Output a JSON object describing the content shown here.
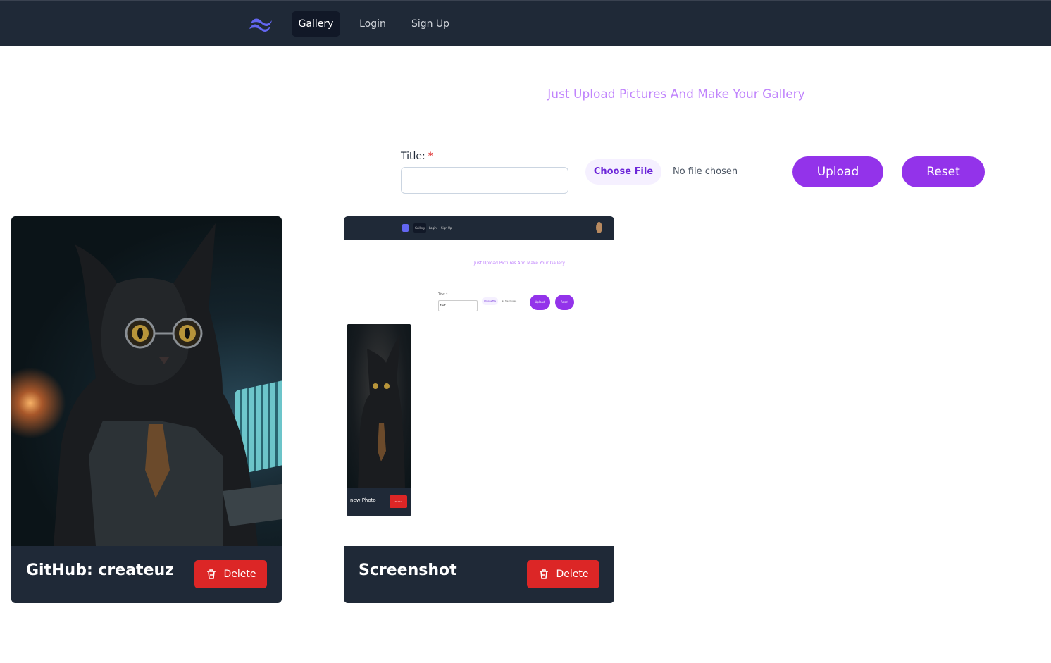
{
  "nav": {
    "items": [
      {
        "label": "Gallery",
        "active": true
      },
      {
        "label": "Login",
        "active": false
      },
      {
        "label": "Sign Up",
        "active": false
      }
    ]
  },
  "hero": {
    "tagline": "Just Upload Pictures And Make Your Gallery"
  },
  "form": {
    "title_label": "Title:",
    "required_marker": "*",
    "title_value": "",
    "choose_file_label": "Choose File",
    "file_status": "No file chosen",
    "upload_label": "Upload",
    "reset_label": "Reset"
  },
  "gallery": {
    "cards": [
      {
        "title": "GitHub: createuz",
        "delete_label": "Delete",
        "image": "cat-with-glasses-photo"
      },
      {
        "title": "Screenshot",
        "delete_label": "Delete",
        "image": "app-screenshot-photo"
      }
    ]
  },
  "preview": {
    "nav_items": [
      "Gallery",
      "Login",
      "Sign Up"
    ],
    "tagline": "Just Upload Pictures And Make Your Gallery",
    "title_label": "Title: *",
    "title_value": "test",
    "choose_file_label": "Choose File",
    "file_status": "No file chosen",
    "upload_label": "Upload",
    "reset_label": "Reset",
    "card_title": "new Photo",
    "delete_label": "Delete"
  },
  "colors": {
    "nav_bg": "#1f2937",
    "accent": "#9333ea",
    "tagline": "#c084fc",
    "danger": "#dc2626",
    "card_bg": "#1f2937"
  }
}
